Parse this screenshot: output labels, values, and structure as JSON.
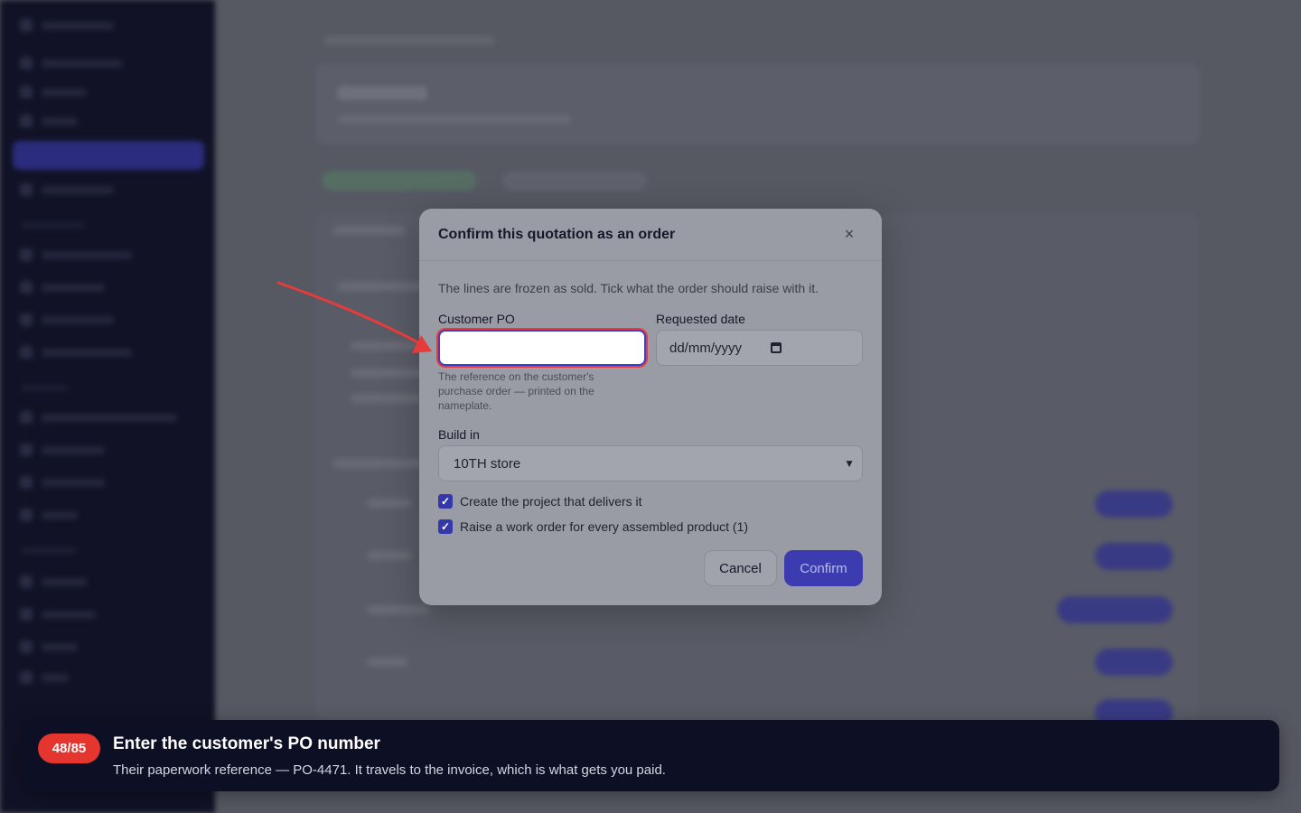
{
  "modal": {
    "title": "Confirm this quotation as an order",
    "close_icon": "×",
    "intro": "The lines are frozen as sold. Tick what the order should raise with it.",
    "customer_po": {
      "label": "Customer PO",
      "value": "",
      "help": "The reference on the customer's purchase order — printed on the nameplate."
    },
    "requested_date": {
      "label": "Requested date",
      "placeholder": "dd/mm/yyyy"
    },
    "build_in": {
      "label": "Build in",
      "selected": "10TH store"
    },
    "checkboxes": [
      {
        "label": "Create the project that delivers it",
        "checked": true
      },
      {
        "label": "Raise a work order for every assembled product (1)",
        "checked": true
      }
    ],
    "cancel_label": "Cancel",
    "confirm_label": "Confirm"
  },
  "tour": {
    "step": "48/85",
    "title": "Enter the customer's PO number",
    "body": "Their paperwork reference — PO-4471. It travels to the invoice, which is what gets you paid."
  },
  "colors": {
    "accent": "#3c3cb0",
    "highlight": "#e63b3b",
    "tour_bg": "#0d0f24"
  }
}
